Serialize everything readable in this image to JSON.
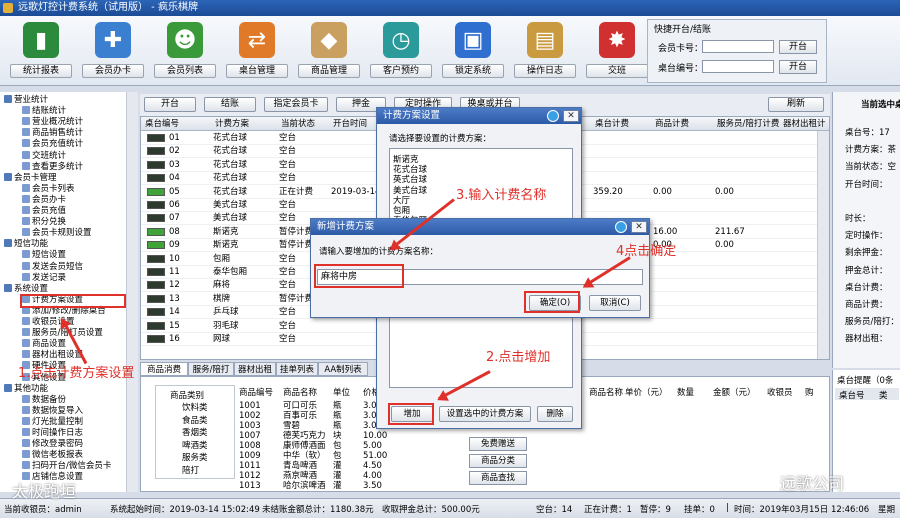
{
  "window": {
    "title": "远歌灯控计费系统（试用版） - 疯乐棋牌"
  },
  "toolbar": {
    "buttons": [
      {
        "label": "统计报表",
        "icon": "bar-chart-icon",
        "color": "#2c8a3c"
      },
      {
        "label": "会员办卡",
        "icon": "add-user-icon",
        "color": "#3a7fd0"
      },
      {
        "label": "会员列表",
        "icon": "users-icon",
        "color": "#3a9a3a"
      },
      {
        "label": "桌台管理",
        "icon": "swap-icon",
        "color": "#e07a28"
      },
      {
        "label": "商品管理",
        "icon": "tag-icon",
        "color": "#c9a060"
      },
      {
        "label": "客户预约",
        "icon": "alarm-clock-icon",
        "color": "#2a9a9a"
      },
      {
        "label": "锁定系统",
        "icon": "lock-icon",
        "color": "#2f6fd0"
      },
      {
        "label": "操作日志",
        "icon": "clipboard-icon",
        "color": "#c99a40"
      },
      {
        "label": "交班",
        "icon": "spark-icon",
        "color": "#d03030"
      }
    ]
  },
  "quick": {
    "title": "快捷开台/结账",
    "card_label": "会员卡号：",
    "table_label": "桌台编号：",
    "open_btn": "开台",
    "open_btn2": "开台"
  },
  "tree": [
    {
      "label": "营业统计",
      "level": 0
    },
    {
      "label": "结账统计",
      "level": 1
    },
    {
      "label": "营业概况统计",
      "level": 1
    },
    {
      "label": "商品销售统计",
      "level": 1
    },
    {
      "label": "会员充值统计",
      "level": 1
    },
    {
      "label": "交班统计",
      "level": 1
    },
    {
      "label": "查看更多统计",
      "level": 1
    },
    {
      "label": "会员卡管理",
      "level": 0
    },
    {
      "label": "会员卡列表",
      "level": 1
    },
    {
      "label": "会员办卡",
      "level": 1
    },
    {
      "label": "会员充值",
      "level": 1
    },
    {
      "label": "积分兑换",
      "level": 1
    },
    {
      "label": "会员卡规则设置",
      "level": 1
    },
    {
      "label": "短信功能",
      "level": 0
    },
    {
      "label": "短信设置",
      "level": 1
    },
    {
      "label": "发送会员短信",
      "level": 1
    },
    {
      "label": "发送记录",
      "level": 1
    },
    {
      "label": "系统设置",
      "level": 0
    },
    {
      "label": "计费方案设置",
      "level": 1
    },
    {
      "label": "添加/修改/删除桌台",
      "level": 1
    },
    {
      "label": "收银员设置",
      "level": 1
    },
    {
      "label": "服务员/陪打员设置",
      "level": 1
    },
    {
      "label": "商品设置",
      "level": 1
    },
    {
      "label": "器材出租设置",
      "level": 1
    },
    {
      "label": "硬件设置",
      "level": 1
    },
    {
      "label": "其他设置",
      "level": 1
    },
    {
      "label": "其他功能",
      "level": 0
    },
    {
      "label": "数据备份",
      "level": 1
    },
    {
      "label": "数据恢复导入",
      "level": 1
    },
    {
      "label": "灯光批量控制",
      "level": 1
    },
    {
      "label": "时间操作日志",
      "level": 1
    },
    {
      "label": "修改登录密码",
      "level": 1
    },
    {
      "label": "微信老板报表",
      "level": 1
    },
    {
      "label": "扫码开台/微信会员卡",
      "level": 1
    },
    {
      "label": "店铺信息设置",
      "level": 1
    }
  ],
  "ctrl": {
    "buttons": [
      "开台",
      "结账",
      "指定会员卡",
      "押金",
      "定时操作",
      "换桌或并台"
    ],
    "refresh": "刷新"
  },
  "table": {
    "headers": [
      "桌台编号",
      "计费方案",
      "当前状态",
      "开台时间",
      "",
      "桌台计费",
      "商品计费",
      "服务员/陪打计费",
      "器材出租计"
    ],
    "rows": [
      {
        "no": "01",
        "plan": "花式台球",
        "status": "空台",
        "time": "",
        "fee": "",
        "goods": "",
        "service": "",
        "green": false
      },
      {
        "no": "02",
        "plan": "花式台球",
        "status": "空台",
        "time": "",
        "fee": "",
        "goods": "",
        "service": "",
        "green": false
      },
      {
        "no": "03",
        "plan": "花式台球",
        "status": "空台",
        "time": "",
        "fee": "",
        "goods": "",
        "service": "",
        "green": false
      },
      {
        "no": "04",
        "plan": "花式台球",
        "status": "空台",
        "time": "",
        "fee": "",
        "goods": "",
        "service": "",
        "green": false
      },
      {
        "no": "05",
        "plan": "花式台球",
        "status": "正在计费",
        "time": "2019-03-14 1",
        "fee": "359.20",
        "goods": "0.00",
        "service": "0.00",
        "green": true
      },
      {
        "no": "06",
        "plan": "美式台球",
        "status": "空台",
        "time": "",
        "fee": "",
        "goods": "",
        "service": "",
        "green": false
      },
      {
        "no": "07",
        "plan": "美式台球",
        "status": "空台",
        "time": "",
        "fee": "",
        "goods": "",
        "service": "",
        "green": false
      },
      {
        "no": "08",
        "plan": "斯诺克",
        "status": "暂停计费",
        "time": "",
        "fee": "",
        "goods": "16.00",
        "service": "211.67",
        "green": true
      },
      {
        "no": "09",
        "plan": "斯诺克",
        "status": "暂停计费",
        "time": "",
        "fee": "",
        "goods": "0.00",
        "service": "0.00",
        "green": true
      },
      {
        "no": "10",
        "plan": "包厢",
        "status": "空台",
        "time": "",
        "fee": "",
        "goods": "",
        "service": "",
        "green": false
      },
      {
        "no": "11",
        "plan": "泰华包厢",
        "status": "空台",
        "time": "",
        "fee": "",
        "goods": "",
        "service": "",
        "green": false
      },
      {
        "no": "12",
        "plan": "麻将",
        "status": "空台",
        "time": "",
        "fee": "",
        "goods": "",
        "service": "",
        "green": false
      },
      {
        "no": "13",
        "plan": "棋牌",
        "status": "暂停计费",
        "time": "",
        "fee": "",
        "goods": "",
        "service": "",
        "green": false
      },
      {
        "no": "14",
        "plan": "乒乓球",
        "status": "空台",
        "time": "",
        "fee": "",
        "goods": "",
        "service": "",
        "green": false
      },
      {
        "no": "15",
        "plan": "羽毛球",
        "status": "空台",
        "time": "",
        "fee": "",
        "goods": "",
        "service": "",
        "green": false
      },
      {
        "no": "16",
        "plan": "网球",
        "status": "空台",
        "time": "",
        "fee": "",
        "goods": "",
        "service": "",
        "green": false
      }
    ]
  },
  "right": {
    "title": "当前选中桌",
    "rows": [
      "桌台号：17",
      "计费方案：茶",
      "当前状态：空",
      "开台时间：",
      "",
      "时长：",
      "定时操作：",
      "剩余押金：",
      "押金总计：",
      "桌台计费：",
      "商品计费：",
      "服务员/陪打：",
      "器材出租：",
      "",
      "消费合计："
    ],
    "remind_title": "桌台提醒（0条",
    "remind_headers": [
      "桌台号",
      "类"
    ]
  },
  "tabs": [
    "商品消费",
    "服务/陪打",
    "器材出租",
    "挂单列表",
    "AA制列表"
  ],
  "lower": {
    "cat_title": "商品类别",
    "cats": [
      "饮料类",
      "食品类",
      "香烟类",
      "啤酒类",
      "服务类",
      "陪打"
    ],
    "prod_headers": [
      "商品编号",
      "商品名称",
      "单位",
      "价格"
    ],
    "products": [
      [
        "1001",
        "可口可乐",
        "瓶",
        "3.00"
      ],
      [
        "1002",
        "百事可乐",
        "瓶",
        "3.00"
      ],
      [
        "1003",
        "雪碧",
        "瓶",
        "3.00"
      ],
      [
        "1007",
        "德芙巧克力",
        "块",
        "10.00"
      ],
      [
        "1008",
        "康师傅酒面",
        "包",
        "5.00"
      ],
      [
        "1009",
        "中华（软）",
        "包",
        "51.00"
      ],
      [
        "1011",
        "青岛啤酒",
        "灌",
        "4.50"
      ],
      [
        "1012",
        "燕京啤酒",
        "灌",
        "4.00"
      ],
      [
        "1013",
        "哈尔滨啤酒",
        "灌",
        "3.50"
      ]
    ],
    "side_btns": [
      "免费赠送",
      "商品分类",
      "商品查找"
    ],
    "order_headers": [
      "商品名称",
      "单价（元）",
      "数量",
      "金额（元）",
      "收银员",
      "购"
    ]
  },
  "status": {
    "cashier": "当前收银员：admin",
    "start": "系统起始时间：2019-03-14 15:02:49",
    "unsettled": "未结账金额总计：1180.38元",
    "deposit": "收取押金总计：500.00元",
    "empty": "空台：14",
    "billing": "正在计费：1",
    "paused": "暂停：9",
    "hung": "挂单：0",
    "dot": "|",
    "time": "时间：2019年03月15日 12:46:06",
    "week": "星期"
  },
  "dlg_plan": {
    "title": "计费方案设置",
    "prompt": "请选择要设置的计费方案：",
    "items": [
      "斯诺克",
      "花式台球",
      "英式台球",
      "美式台球",
      "大厅",
      "包厢",
      "泰华包厢"
    ],
    "add_btn": "增加",
    "setup_btn": "设置选中的计费方案",
    "del_btn": "删除"
  },
  "dlg_new": {
    "title": "新增计费方案",
    "prompt": "请输入要增加的计费方案名称：",
    "value": "麻将中房",
    "ok_btn": "确定(O)",
    "cancel_btn": "取消(C)"
  },
  "annotations": {
    "step1": "1.点击计费方案设置",
    "step2": "2.点击增加",
    "step3": "3.输入计费名称",
    "step4": "4点击确定",
    "accent": "#e0302a"
  },
  "watermarks": {
    "left": "太极跑垣",
    "right": "远歌公司"
  }
}
